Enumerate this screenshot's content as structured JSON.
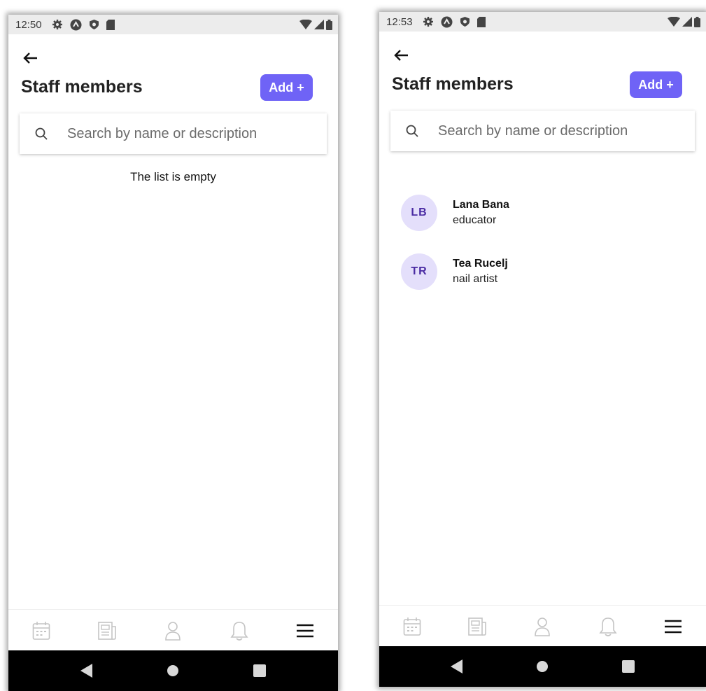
{
  "screens": [
    {
      "status_time": "12:50",
      "title": "Staff members",
      "add_label": "Add +",
      "search_placeholder": "Search by name or description",
      "empty_text": "The list is empty",
      "staff": []
    },
    {
      "status_time": "12:53",
      "title": "Staff members",
      "add_label": "Add +",
      "search_placeholder": "Search by name or description",
      "staff": [
        {
          "initials": "LB",
          "name": "Lana Bana",
          "description": "educator"
        },
        {
          "initials": "TR",
          "name": "Tea Rucelj",
          "description": "nail artist"
        }
      ]
    }
  ],
  "nav_items": [
    "calendar-icon",
    "news-icon",
    "person-icon",
    "bell-icon",
    "menu-icon"
  ],
  "colors": {
    "accent": "#6f63f6",
    "avatar_bg": "#e4dffb",
    "avatar_text": "#4a2ba3",
    "nav_inactive": "#c4c4c4",
    "nav_active": "#111111"
  }
}
